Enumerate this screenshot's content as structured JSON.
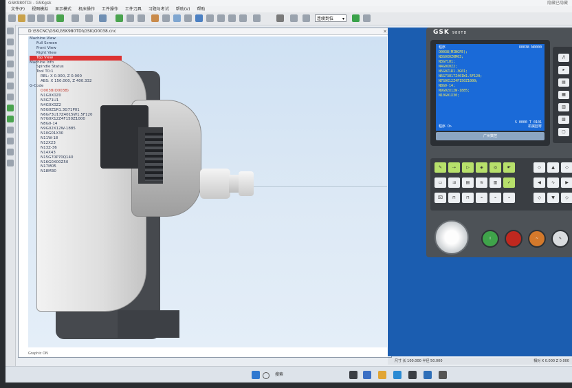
{
  "window": {
    "title": "GSK980TDi - GSKgsk",
    "title_right": "隐藏已隐藏"
  },
  "menu": [
    "文件(F)",
    "视图模拟",
    "显示模式",
    "机床操作",
    "工件操作",
    "工件刀具",
    "习题与考试",
    "帮助(V)",
    "帮助"
  ],
  "toolbar": {
    "mode_select": "连续到位"
  },
  "viewport": {
    "path": "D:\\SSCNC\\GSK\\GSK980TDi\\GSK\\O0038.cnc",
    "status": "Graphic ON",
    "tree": [
      {
        "text": "Machine View",
        "kind": "head"
      },
      {
        "text": "Full Screen",
        "kind": "item"
      },
      {
        "text": "Front View",
        "kind": "item"
      },
      {
        "text": "Right View",
        "kind": "item"
      },
      {
        "text": "Top View",
        "kind": "sel"
      },
      {
        "text": "Machine Info",
        "kind": "head"
      },
      {
        "text": "Spindle Status",
        "kind": "item"
      },
      {
        "text": "Tool T0:1",
        "kind": "item"
      },
      {
        "text": "REL: X  0.000, Z  0.000",
        "kind": "plain"
      },
      {
        "text": "ABS: X 150.000, Z 400.332",
        "kind": "plain"
      },
      {
        "text": "G-Code",
        "kind": "head"
      },
      {
        "text": "O0038(O0038)",
        "kind": "red"
      },
      {
        "text": "N1G0X0Z0",
        "kind": "code"
      },
      {
        "text": "N3G71U1",
        "kind": "code"
      },
      {
        "text": "N4G0X0Z2",
        "kind": "code"
      },
      {
        "text": "N5G0Z1R1.3G71P01",
        "kind": "code"
      },
      {
        "text": "N6G73U17Z4015W1.5F120",
        "kind": "code"
      },
      {
        "text": "N7G0X12Z4F150Z1000",
        "kind": "code"
      },
      {
        "text": "N8G0-14",
        "kind": "code"
      },
      {
        "text": "N9G02X12W-1885",
        "kind": "code"
      },
      {
        "text": "N10G01X30",
        "kind": "code"
      },
      {
        "text": "N11W-18",
        "kind": "code"
      },
      {
        "text": "N12X23",
        "kind": "code"
      },
      {
        "text": "N13Z-36",
        "kind": "code"
      },
      {
        "text": "N14X43",
        "kind": "code"
      },
      {
        "text": "N15G70P70Q140",
        "kind": "code"
      },
      {
        "text": "N16G0X00Z50",
        "kind": "code"
      },
      {
        "text": "N17M05",
        "kind": "code"
      },
      {
        "text": "N18M30",
        "kind": "code"
      }
    ]
  },
  "cnc": {
    "brand": "GSK",
    "model": "980TD",
    "screen_title": "程序",
    "screen_title_right": "O0038  N0000",
    "program_lines": [
      "O0038(MINGFE);",
      "N3G0X0Z0M03;",
      "N3G71U1;",
      "N4G0X0Z2;",
      "N5G0Z1R1.3G01;",
      "N6G73U17Z401W1.5F120;",
      "N7G0X12Z4F150Z1000;",
      "N8G0-14;",
      "N9G02X12W-1885;",
      "N10G01X30;"
    ],
    "screen_bottom_left": "S 0000  T 0101",
    "screen_bottom_right": "机械回零",
    "screen_label": "程序 O>",
    "footer": "广州数控"
  },
  "statusbar": {
    "left": "尺寸 长 100.000 半径 50.000",
    "right": "相对 X  0.000  Z  0.000"
  },
  "taskbar": {
    "search": "搜索"
  }
}
